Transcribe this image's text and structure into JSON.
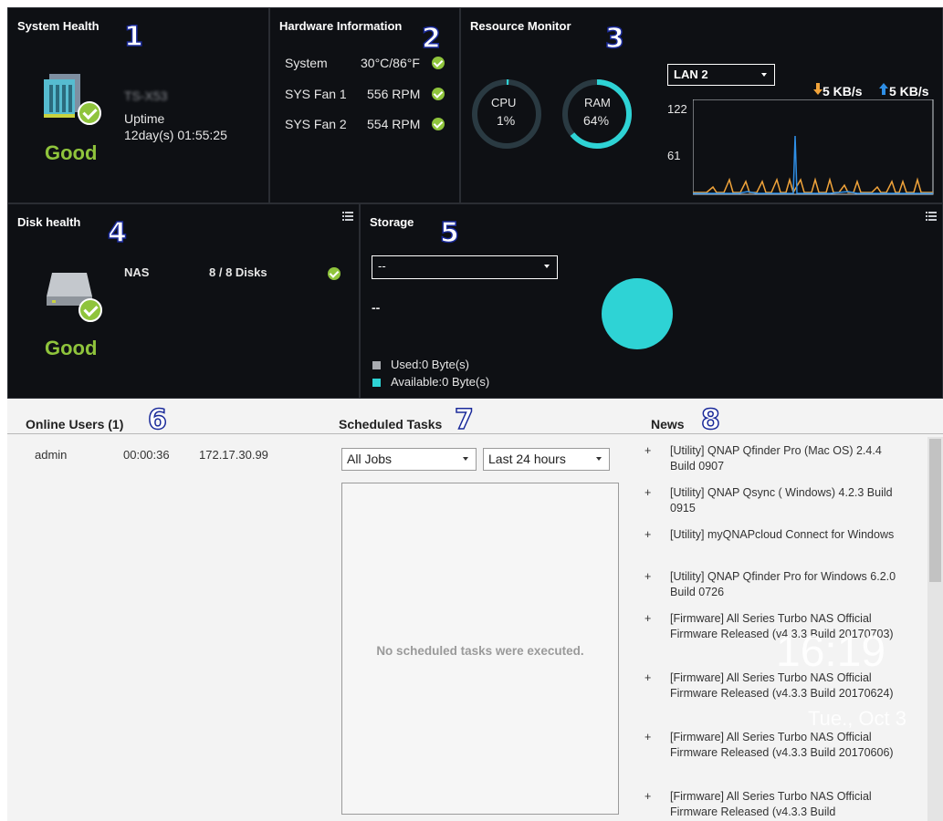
{
  "system_health": {
    "title": "System Health",
    "hostname": "TS-X53",
    "uptime_label": "Uptime",
    "uptime_value": "12day(s) 01:55:25",
    "status": "Good",
    "marker": "1"
  },
  "hardware": {
    "title": "Hardware Information",
    "marker": "2",
    "rows": [
      {
        "label": "System",
        "value": "30°C/86°F"
      },
      {
        "label": "SYS Fan 1",
        "value": "556 RPM"
      },
      {
        "label": "SYS Fan 2",
        "value": "554 RPM"
      }
    ]
  },
  "resource": {
    "title": "Resource Monitor",
    "marker": "3",
    "cpu_label": "CPU",
    "cpu_value": "1%",
    "cpu_fraction": 0.01,
    "ram_label": "RAM",
    "ram_value": "64%",
    "ram_fraction": 0.64,
    "lan_select": "LAN 2",
    "download": "5 KB/s",
    "upload": "5 KB/s",
    "tick_high": "122",
    "tick_mid": "61"
  },
  "disk": {
    "title": "Disk health",
    "marker": "4",
    "name": "NAS",
    "disks": "8 / 8 Disks",
    "status": "Good"
  },
  "storage": {
    "title": "Storage",
    "marker": "5",
    "select": "--",
    "value": "--",
    "used": "Used:0 Byte(s)",
    "available": "Available:0 Byte(s)"
  },
  "online_users": {
    "title": "Online Users (1)",
    "marker": "6",
    "users": [
      {
        "name": "admin",
        "time": "00:00:36",
        "ip": "172.17.30.99"
      }
    ]
  },
  "tasks": {
    "title": "Scheduled Tasks",
    "marker": "7",
    "filter_jobs": "All Jobs",
    "filter_time": "Last 24 hours",
    "empty": "No scheduled tasks were executed."
  },
  "news": {
    "title": "News",
    "marker": "8",
    "items": [
      "[Utility] QNAP Qfinder Pro (Mac OS) 2.4.4 Build 0907",
      "[Utility] QNAP Qsync ( Windows) 4.2.3 Build 0915",
      "[Utility] myQNAPcloud Connect for Windows",
      "[Utility] QNAP Qfinder Pro for Windows 6.2.0 Build 0726",
      "[Firmware] All Series Turbo NAS Official Firmware Released (v4.3.3 Build 20170703)",
      "[Firmware] All Series Turbo NAS Official Firmware Released (v4.3.3 Build 20170624)",
      "[Firmware] All Series Turbo NAS Official Firmware Released (v4.3.3 Build 20170606)",
      "[Firmware] All Series Turbo NAS Official Firmware Released (v4.3.3 Build"
    ]
  },
  "clock": {
    "time": "16:19",
    "date": "Tue., Oct 3"
  },
  "colors": {
    "good": "#8fc43c",
    "accent": "#2ed3d5",
    "download": "#f0a33a",
    "upload": "#2f8fe6"
  }
}
